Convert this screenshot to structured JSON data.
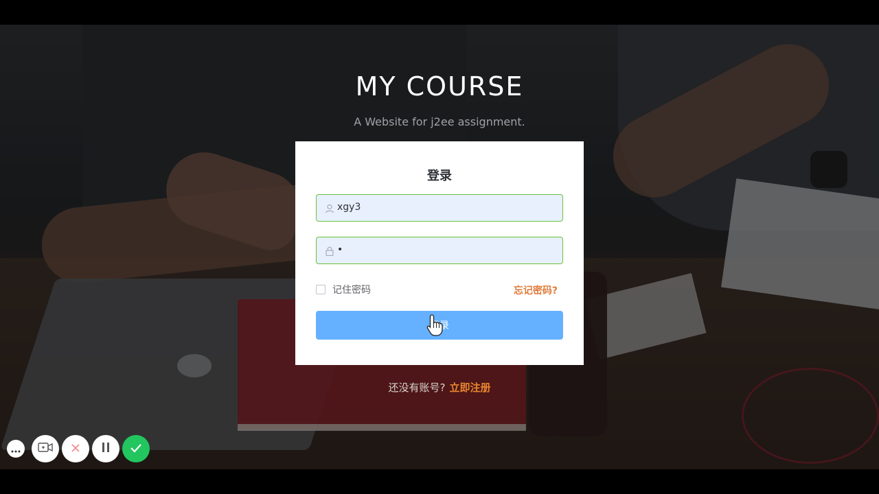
{
  "header": {
    "title": "MY COURSE",
    "subtitle": "A Website for j2ee assignment."
  },
  "login_card": {
    "title": "登录",
    "username": {
      "value": "xgy3",
      "icon": "user-icon"
    },
    "password": {
      "value": "•",
      "icon": "lock-icon"
    },
    "remember_label": "记住密码",
    "forgot_label": "忘记密码?",
    "submit_label": "登录"
  },
  "register": {
    "question": "还没有账号?",
    "link_label": "立即注册"
  },
  "recorder_toolbar": {
    "buttons": [
      "more-icon",
      "camera-icon",
      "close-icon",
      "pause-icon",
      "check-icon"
    ]
  },
  "colors": {
    "accent_green": "#67c23a",
    "button_blue": "#66b1ff",
    "link_orange": "#e8862e",
    "field_bg": "#e8f0fe"
  }
}
